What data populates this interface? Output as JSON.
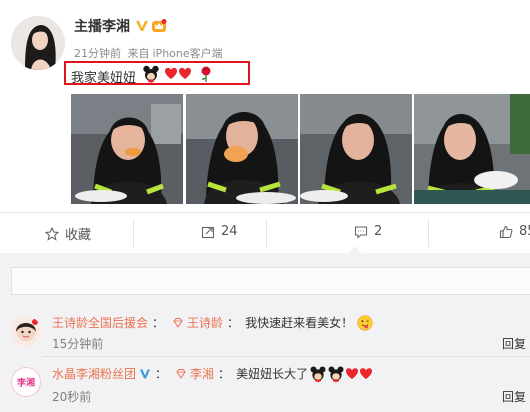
{
  "post": {
    "author": "主播李湘",
    "time": "21分钟前",
    "source_prefix": "来自",
    "source": "iPhone客户端",
    "text": "我家美妞妞"
  },
  "actions": {
    "favorite": "收藏",
    "repost_count": "24",
    "comment_count": "2",
    "like_count": "85"
  },
  "comments": [
    {
      "user": "王诗龄全国后援会",
      "mention": "王诗龄",
      "text": "我快速赶来看美女！",
      "time": "15分钟前",
      "reply": "回复"
    },
    {
      "user": "水晶李湘粉丝团",
      "mention": "李湘",
      "text": "美妞妞长大了",
      "time": "20秒前",
      "reply": "回复",
      "avatar_text": "李湘"
    }
  ],
  "colors": {
    "highlight": "#e0141e",
    "verified": "#f6b120",
    "commenter_name": "#eb7350",
    "heart": "#e8262b"
  }
}
